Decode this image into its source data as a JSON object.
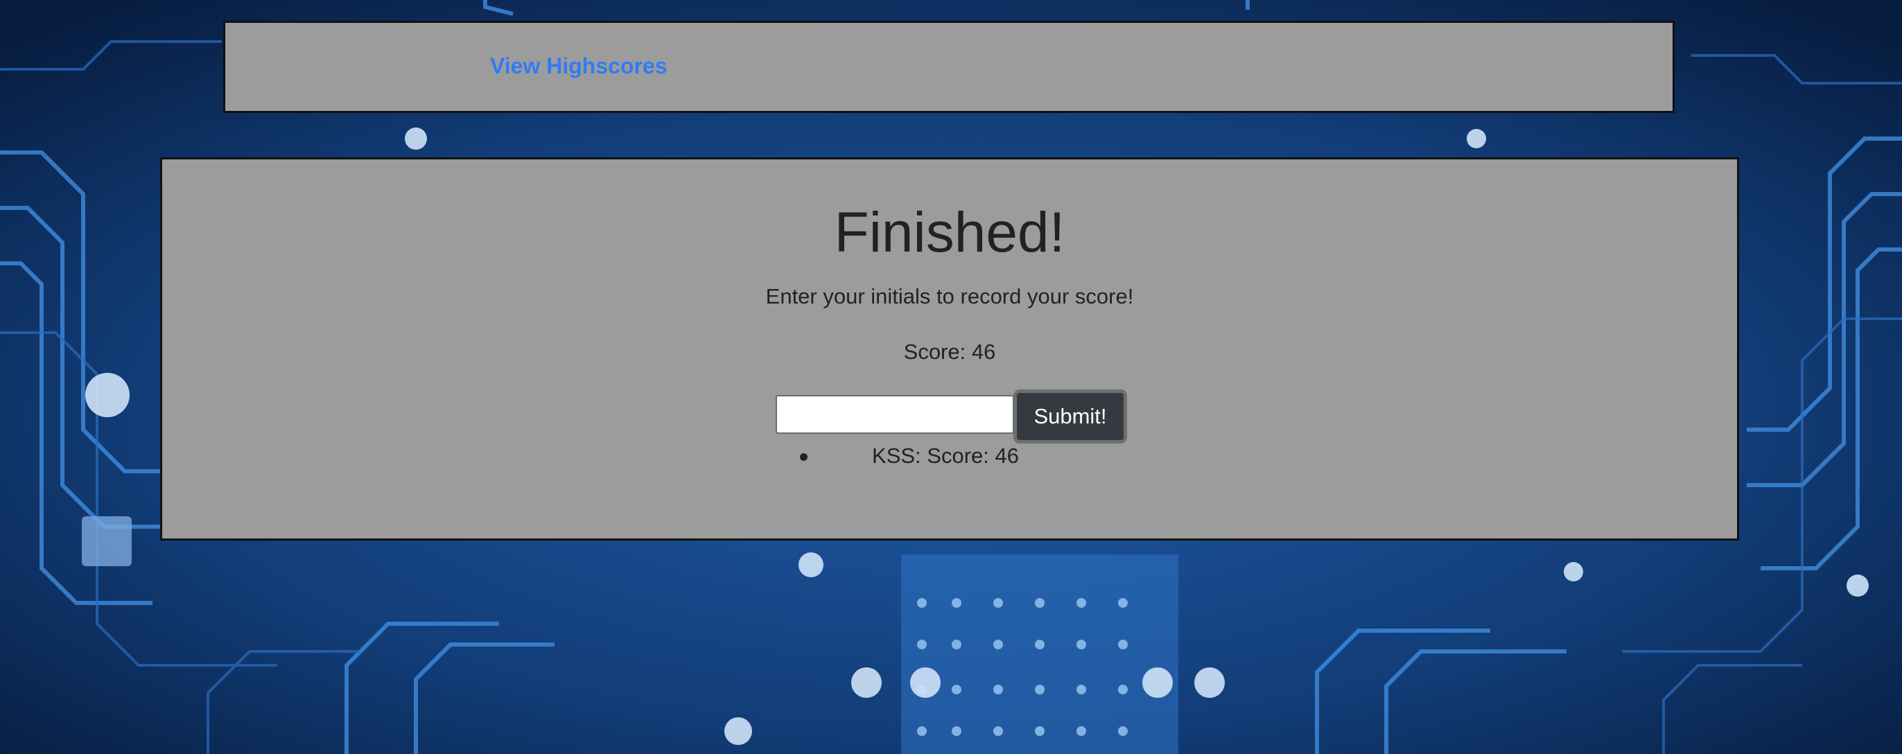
{
  "header": {
    "highscores_link": "View Highscores"
  },
  "main": {
    "title": "Finished!",
    "subtitle": "Enter your initials to record your score!",
    "score_text": "Score: 46",
    "initials_input": {
      "value": "",
      "placeholder": ""
    },
    "submit_label": "Submit!",
    "highscores": [
      "KSS: Score: 46"
    ]
  },
  "colors": {
    "panel_background": "#9c9c9c",
    "link": "#2f7cf6",
    "button_background": "#343a40",
    "page_background": "#0a2a55"
  }
}
